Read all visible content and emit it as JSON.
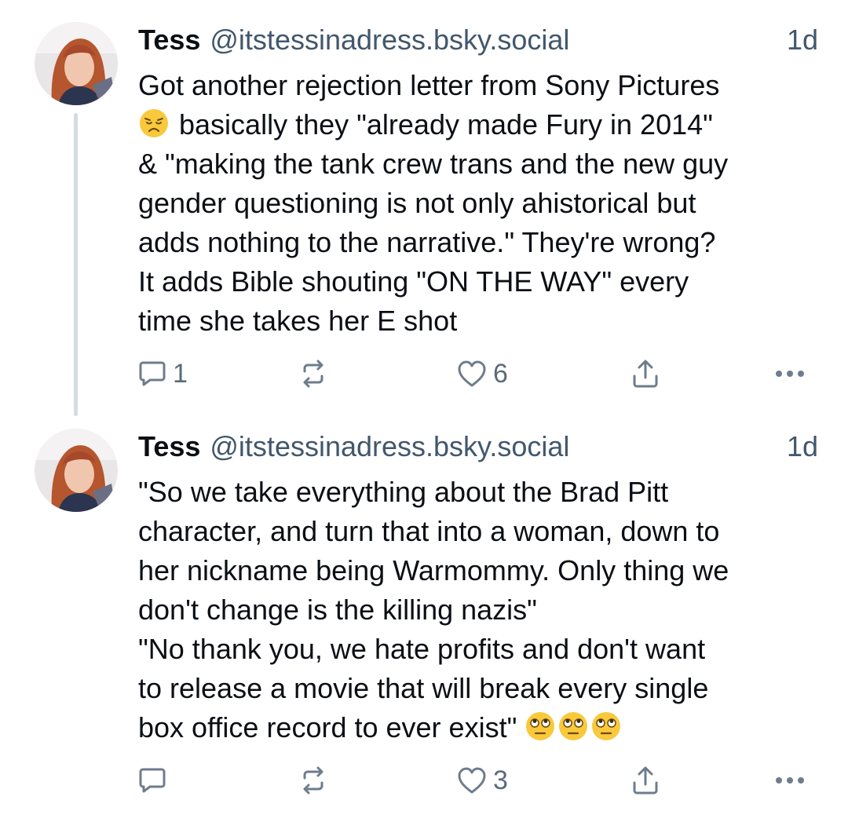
{
  "posts": [
    {
      "display_name": "Tess",
      "handle": "@itstessinadress.bsky.social",
      "time": "1d",
      "text_lines": [
        "Got another rejection letter from Sony Pictures",
        "basically they \"already made Fury in 2014\"",
        "& \"making the tank crew trans and the new guy",
        "gender questioning is not only ahistorical but",
        "adds nothing to the narrative.\" They're wrong?",
        "It adds Bible shouting \"ON THE WAY\" every",
        "time she takes her E shot"
      ],
      "emoji": "weary-face",
      "reply_count": "1",
      "repost_count": "",
      "like_count": "6"
    },
    {
      "display_name": "Tess",
      "handle": "@itstessinadress.bsky.social",
      "time": "1d",
      "text_lines": [
        "\"So we take everything about the Brad Pitt",
        "character, and turn that into a woman, down to",
        "her nickname being Warmommy. Only thing we",
        "don't change is the killing nazis\"",
        "\"No thank you, we hate profits and don't want",
        "to release a movie that will break every single",
        "box office record to ever exist\""
      ],
      "emoji": "eye-roll-face x3",
      "reply_count": "",
      "repost_count": "",
      "like_count": "3"
    }
  ],
  "colors": {
    "text": "#0b0f14",
    "muted": "#42576c",
    "icon": "#6e7c8c",
    "thread_line": "#d4dbe2",
    "emoji_yellow": "#f9c93b"
  }
}
